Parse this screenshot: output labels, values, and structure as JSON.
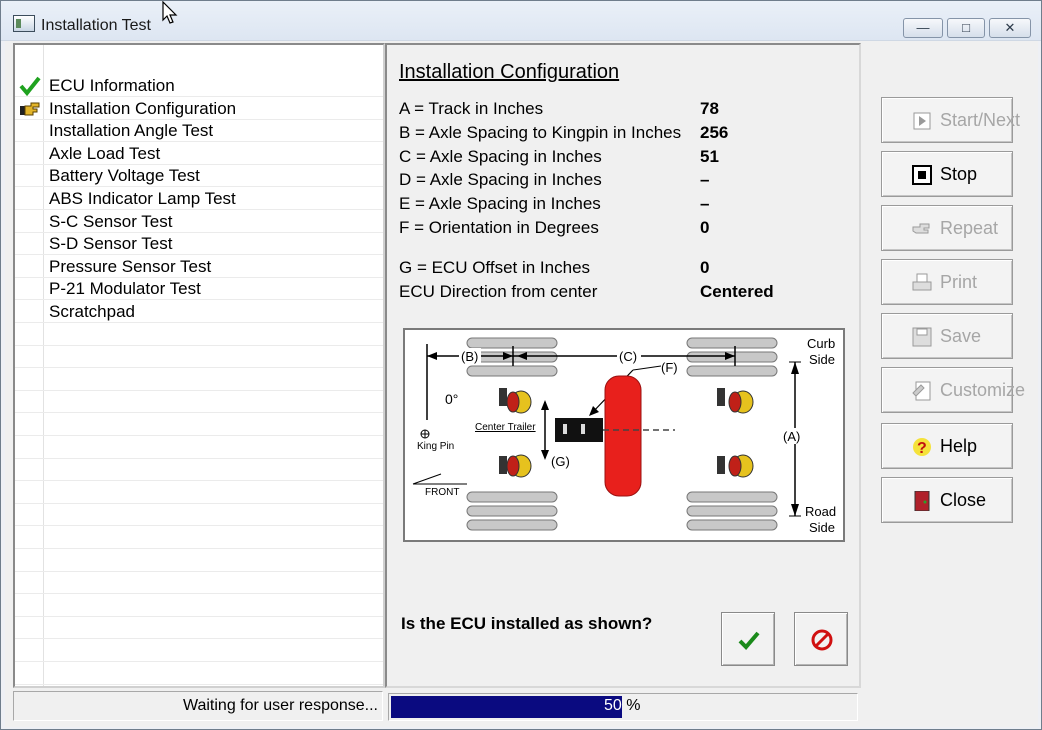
{
  "window": {
    "title": "Installation Test",
    "min": "—",
    "max": "□",
    "close": "✕"
  },
  "tests": [
    {
      "label": "ECU Information",
      "icon": "checkmark-icon"
    },
    {
      "label": "Installation Configuration",
      "icon": "pointing-hand-icon"
    },
    {
      "label": "Installation Angle Test",
      "icon": ""
    },
    {
      "label": "Axle Load Test",
      "icon": ""
    },
    {
      "label": "Battery Voltage Test",
      "icon": ""
    },
    {
      "label": "ABS Indicator Lamp Test",
      "icon": ""
    },
    {
      "label": "S-C Sensor Test",
      "icon": ""
    },
    {
      "label": "S-D Sensor Test",
      "icon": ""
    },
    {
      "label": "Pressure Sensor Test",
      "icon": ""
    },
    {
      "label": "P-21 Modulator Test",
      "icon": ""
    },
    {
      "label": "Scratchpad",
      "icon": ""
    }
  ],
  "config": {
    "title": "Installation Configuration",
    "rows": [
      {
        "label": "A = Track in Inches",
        "value": "78"
      },
      {
        "label": "B = Axle Spacing to Kingpin in Inches",
        "value": "256"
      },
      {
        "label": "C = Axle Spacing in Inches",
        "value": "51"
      },
      {
        "label": "D = Axle Spacing in Inches",
        "value": "–"
      },
      {
        "label": "E = Axle Spacing in Inches",
        "value": "–"
      },
      {
        "label": "F = Orientation in Degrees",
        "value": "0"
      }
    ],
    "rows2": [
      {
        "label": "G = ECU Offset in Inches",
        "value": "0"
      },
      {
        "label": "ECU Direction from center",
        "value": "Centered"
      }
    ]
  },
  "diagram": {
    "curb_side": [
      "Curb",
      "Side"
    ],
    "road_side": [
      "Road",
      "Side"
    ],
    "b_label": "(B)",
    "c_label": "(C)",
    "f_label": "(F)",
    "a_label": "(A)",
    "g_label": "(G)",
    "degrees": "0°",
    "center_trailer": "Center Trailer",
    "king_pin": "King Pin",
    "front": "FRONT"
  },
  "question": "Is the ECU installed as shown?",
  "yes_icon": "checkmark-icon",
  "no_icon": "prohibited-icon",
  "buttons": [
    {
      "label": "Start/Next",
      "icon": "play-icon",
      "enabled": false
    },
    {
      "label": "Stop",
      "icon": "stop-icon",
      "enabled": true
    },
    {
      "label": "Repeat",
      "icon": "repeat-hand-icon",
      "enabled": false
    },
    {
      "label": "Print",
      "icon": "printer-icon",
      "enabled": false
    },
    {
      "label": "Save",
      "icon": "floppy-disk-icon",
      "enabled": false
    },
    {
      "label": "Customize",
      "icon": "customize-icon",
      "enabled": false
    },
    {
      "label": "Help",
      "icon": "help-icon",
      "enabled": true
    },
    {
      "label": "Close",
      "icon": "door-icon",
      "enabled": true
    }
  ],
  "status": {
    "message": "Waiting for user response...",
    "progress_value": "50",
    "progress_unit": "%",
    "progress_fraction": 0.5
  },
  "colors": {
    "progress": "#0a0a80",
    "tank": "#e8201c",
    "accent_green": "#1a8a1a",
    "stop_red": "#d01010"
  }
}
